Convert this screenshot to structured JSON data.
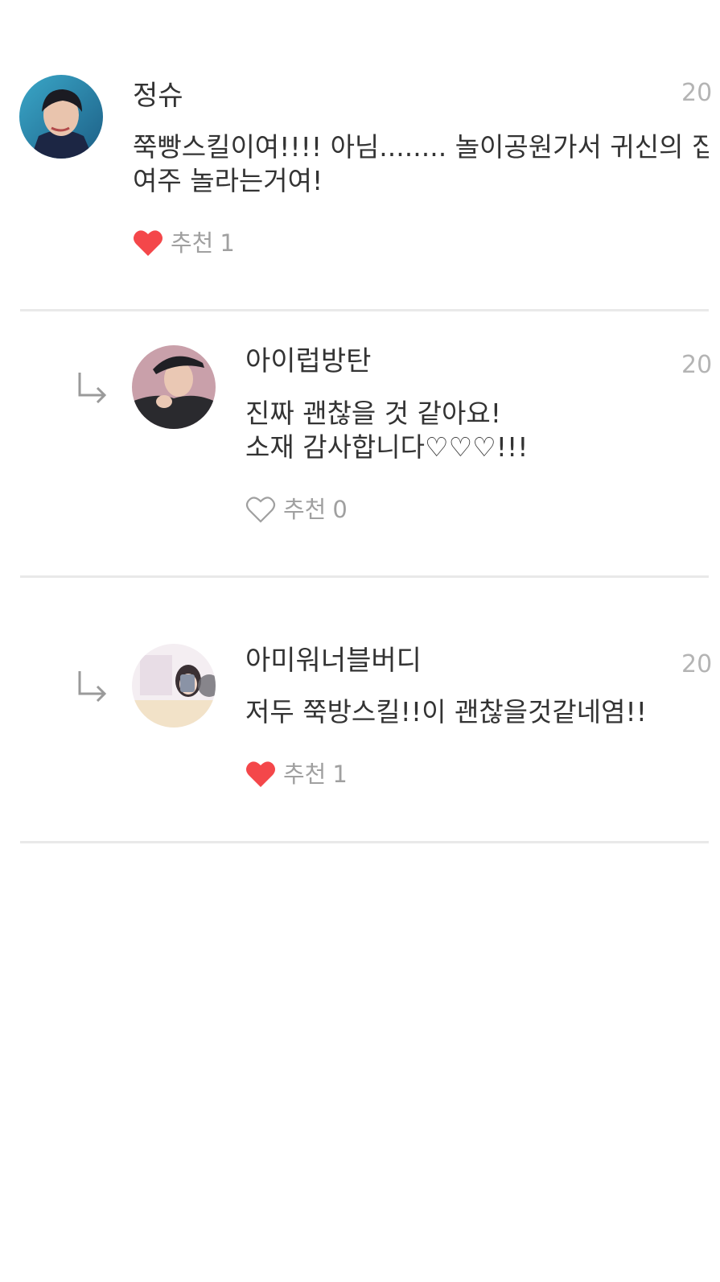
{
  "comments": [
    {
      "author": "정슈",
      "date": "20",
      "text": "쭉빵스킬이여!!!! 아님........ 놀이공원가서 귀신의 집\n여주 놀라는거여!",
      "like_label": "추천",
      "like_count": "1",
      "liked": true,
      "is_reply": false
    },
    {
      "author": "아이럽방탄",
      "date": "20",
      "text": "진짜 괜찮을 것 같아요!\n소재 감사합니다♡♡♡!!!",
      "like_label": "추천",
      "like_count": "0",
      "liked": false,
      "is_reply": true
    },
    {
      "author": "아미워너블버디",
      "date": "20",
      "text": "저두 쭉방스킬!!이 괜찮을것같네염!!",
      "like_label": "추천",
      "like_count": "1",
      "liked": true,
      "is_reply": true
    }
  ],
  "colors": {
    "heart_filled": "#f4474a",
    "heart_outline": "#a0a0a0",
    "divider": "#e9e9e9",
    "muted_text": "#a0a0a0",
    "date_text": "#b4b4b4"
  }
}
